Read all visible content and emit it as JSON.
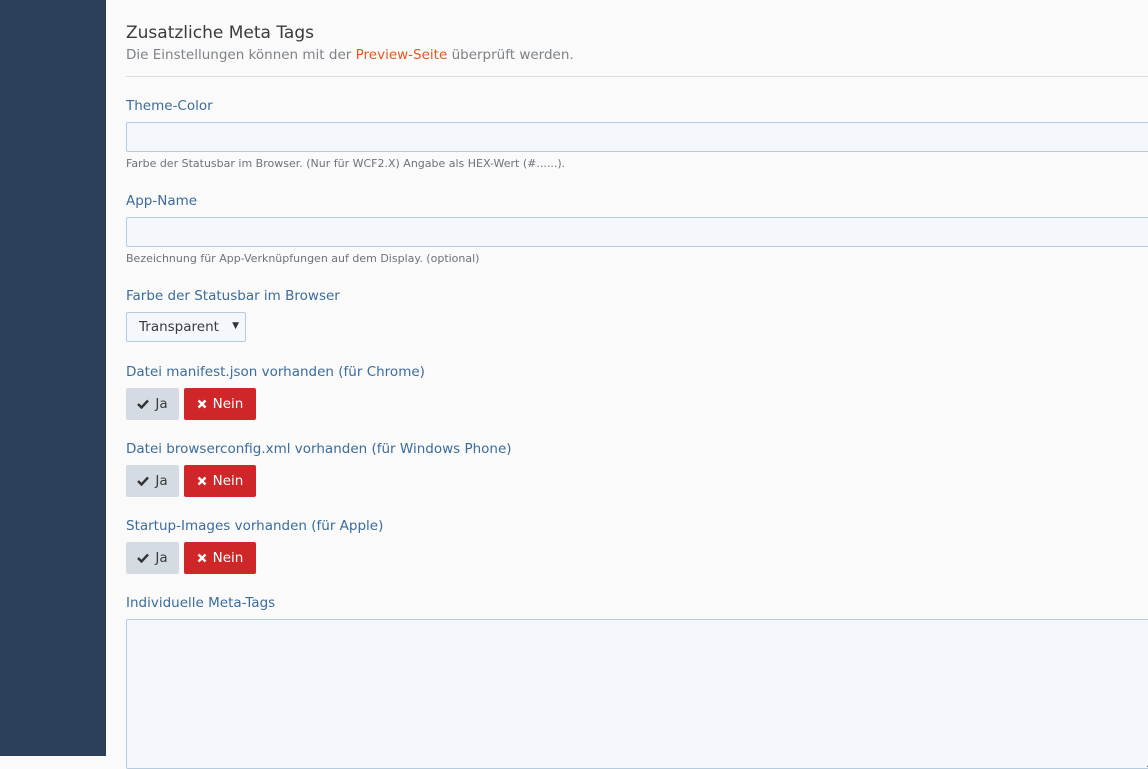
{
  "section": {
    "title": "Zusatzliche Meta Tags",
    "desc_before": "Die Einstellungen können mit der ",
    "desc_link": "Preview-Seite",
    "desc_after": " überprüft werden."
  },
  "fields": {
    "theme_color": {
      "label": "Theme-Color",
      "value": "",
      "hint": "Farbe der Statusbar im Browser. (Nur für WCF2.X) Angabe als HEX-Wert (#......)."
    },
    "app_name": {
      "label": "App-Name",
      "value": "",
      "hint": "Bezeichnung für App-Verknüpfungen auf dem Display. (optional)"
    },
    "statusbar": {
      "label": "Farbe der Statusbar im Browser",
      "selected": "Transparent"
    },
    "manifest": {
      "label": "Datei manifest.json vorhanden (für Chrome)"
    },
    "browserconfig": {
      "label": "Datei browserconfig.xml vorhanden (für Windows Phone)"
    },
    "startup_images": {
      "label": "Startup-Images vorhanden (für Apple)"
    },
    "custom_meta": {
      "label": "Individuelle Meta-Tags",
      "value": ""
    }
  },
  "toggle": {
    "yes_label": "Ja",
    "no_label": "Nein",
    "yes_icon": "checkmark-icon",
    "no_icon": "x-icon"
  },
  "colors": {
    "sidebar": "#2b4058",
    "label": "#3b6c9c",
    "link": "#e2591e",
    "no_button": "#cf2729",
    "yes_button": "#d4dbe3"
  }
}
